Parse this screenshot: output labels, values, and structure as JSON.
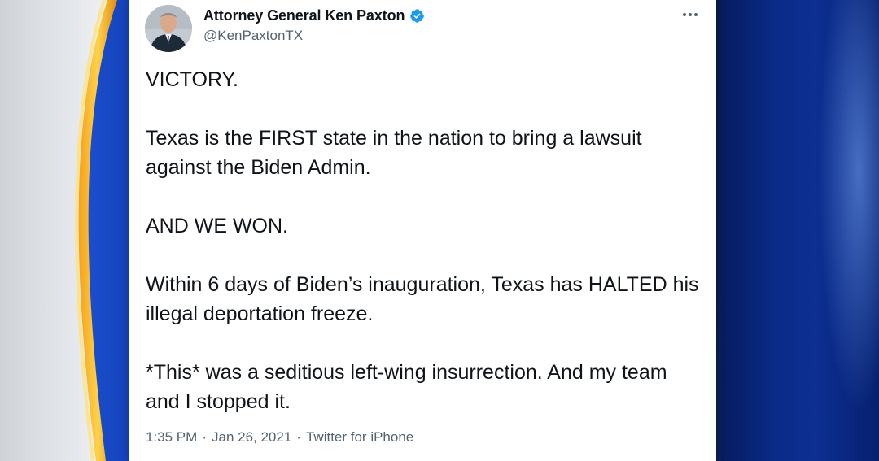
{
  "tweet": {
    "display_name": "Attorney General Ken Paxton",
    "handle": "@KenPaxtonTX",
    "verified": true,
    "paragraphs": [
      "VICTORY.",
      "Texas is the FIRST state in the nation to bring a lawsuit against the Biden Admin.",
      "AND WE WON.",
      "Within 6 days of Biden’s inauguration, Texas has HALTED his illegal deportation freeze.",
      "*This* was a seditious left-wing insurrection. And my team and I stopped it."
    ],
    "time": "1:35 PM",
    "date": "Jan 26, 2021",
    "source": "Twitter for iPhone",
    "separator": "·"
  },
  "icons": {
    "verified": "verified-badge-icon",
    "more": "more-options-icon"
  },
  "colors": {
    "accent": "#1d9bf0",
    "text": "#0f1419",
    "secondary_text": "#536471",
    "background_right": "#0a2a86"
  }
}
